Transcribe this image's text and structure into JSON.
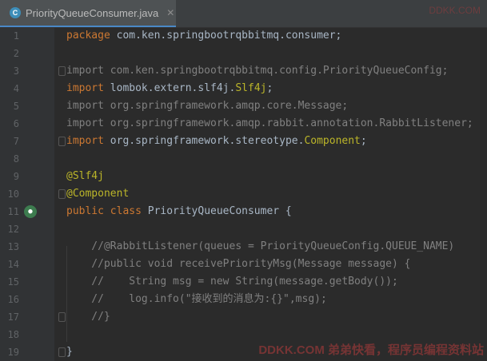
{
  "tab": {
    "icon": "C",
    "filename": "PriorityQueueConsumer.java",
    "close": "✕"
  },
  "lines": [
    {
      "n": "1",
      "parts": [
        [
          "kw",
          "package "
        ],
        [
          "cls",
          "com.ken.springbootrqbbitmq.consumer;"
        ]
      ]
    },
    {
      "n": "2",
      "parts": []
    },
    {
      "n": "3",
      "parts": [
        [
          "gray",
          "import com.ken.springbootrqbbitmq.config.PriorityQueueConfig;"
        ]
      ]
    },
    {
      "n": "4",
      "parts": [
        [
          "kw",
          "import "
        ],
        [
          "cls",
          "lombok.extern.slf4j."
        ],
        [
          "yel",
          "Slf4j"
        ],
        [
          "cls",
          ";"
        ]
      ]
    },
    {
      "n": "5",
      "parts": [
        [
          "gray",
          "import org.springframework.amqp.core.Message;"
        ]
      ]
    },
    {
      "n": "6",
      "parts": [
        [
          "gray",
          "import org.springframework.amqp.rabbit.annotation.RabbitListener;"
        ]
      ]
    },
    {
      "n": "7",
      "parts": [
        [
          "kw",
          "import "
        ],
        [
          "cls",
          "org.springframework.stereotype."
        ],
        [
          "yel",
          "Component"
        ],
        [
          "cls",
          ";"
        ]
      ]
    },
    {
      "n": "8",
      "parts": []
    },
    {
      "n": "9",
      "parts": [
        [
          "ann",
          "@Slf4j"
        ]
      ]
    },
    {
      "n": "10",
      "parts": [
        [
          "ann",
          "@Component"
        ]
      ]
    },
    {
      "n": "11",
      "parts": [
        [
          "kw",
          "public class "
        ],
        [
          "cls",
          "PriorityQueueConsumer {"
        ]
      ]
    },
    {
      "n": "12",
      "parts": []
    },
    {
      "n": "13",
      "parts": [
        [
          "cmt",
          "    //@RabbitListener(queues = PriorityQueueConfig.QUEUE_NAME)"
        ]
      ]
    },
    {
      "n": "14",
      "parts": [
        [
          "cmt",
          "    //public void receivePriorityMsg(Message message) {"
        ]
      ]
    },
    {
      "n": "15",
      "parts": [
        [
          "cmt",
          "    //    String msg = new String(message.getBody());"
        ]
      ]
    },
    {
      "n": "16",
      "parts": [
        [
          "cmt",
          "    //    log.info(\"接收到的消息为:{}\",msg);"
        ]
      ]
    },
    {
      "n": "17",
      "parts": [
        [
          "cmt",
          "    //}"
        ]
      ]
    },
    {
      "n": "18",
      "parts": []
    },
    {
      "n": "19",
      "parts": [
        [
          "cls",
          "}"
        ]
      ]
    }
  ],
  "watermark": "DDKK.COM 弟弟快看，程序员编程资料站",
  "watermark_top": "DDKK.COM"
}
